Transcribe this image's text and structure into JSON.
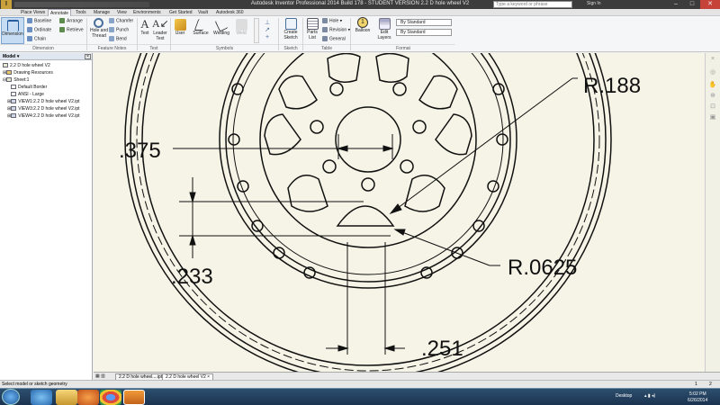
{
  "window": {
    "title": "Autodesk Inventor Professional 2014 Build 178 - STUDENT VERSION   2.2 D hole wheel V2",
    "search_placeholder": "Type a keyword or phrase",
    "signin": "Sign In"
  },
  "tabs": [
    "Place Views",
    "Annotate",
    "Tools",
    "Manage",
    "View",
    "Environments",
    "Get Started",
    "Vault",
    "Autodesk 360"
  ],
  "active_tab": "Annotate",
  "ribbon": {
    "dimension": {
      "label": "Dimension",
      "baseline": "Baseline",
      "ordinate": "Ordinate",
      "chain": "Chain",
      "arrange": "Arrange",
      "retrieve": "Retrieve",
      "group": "Dimension"
    },
    "feature_notes": {
      "hole_thread": "Hole and Thread",
      "chamfer": "Chamfer",
      "punch": "Punch",
      "bend": "Bend",
      "group": "Feature Notes"
    },
    "text": {
      "text": "Text",
      "leader_text": "Leader Text",
      "group": "Text"
    },
    "symbols": {
      "user": "User",
      "surface": "Surface",
      "welding": "Welding",
      "weld": "Weld",
      "group": "Symbols"
    },
    "sketch": {
      "create": "Create Sketch",
      "group": "Sketch"
    },
    "table": {
      "parts_list": "Parts List",
      "hole": "Hole",
      "revision": "Revision",
      "general": "General",
      "group": "Table"
    },
    "balloon": {
      "label": "Balloon",
      "edit_layers": "Edit Layers"
    },
    "format": {
      "style1": "By Standard",
      "style2": "By Standard",
      "group": "Format"
    }
  },
  "browser": {
    "header": "Model",
    "nodes": [
      "2.2 D hole wheel V2",
      "Drawing Resources",
      "Sheet:1",
      "Default Border",
      "ANSI - Large",
      "VIEW1:2.2 D hole wheel V2.ipt",
      "VIEW3:2.2 D hole wheel V2.ipt",
      "VIEW4:2.2 D hole wheel V2.ipt"
    ]
  },
  "drawing": {
    "dimensions": [
      ".375",
      "R.188",
      ".233",
      "R.0625",
      ".251"
    ]
  },
  "doc_tabs": [
    "2.2 D hole wheel....ipt",
    "2.2 D hole wheel V2"
  ],
  "status": {
    "text": "Select model or sketch geometry",
    "page_a": "1",
    "page_b": "2"
  },
  "taskbar": {
    "desktop": "Desktop",
    "time": "5:02 PM",
    "date": "6/26/2014"
  }
}
